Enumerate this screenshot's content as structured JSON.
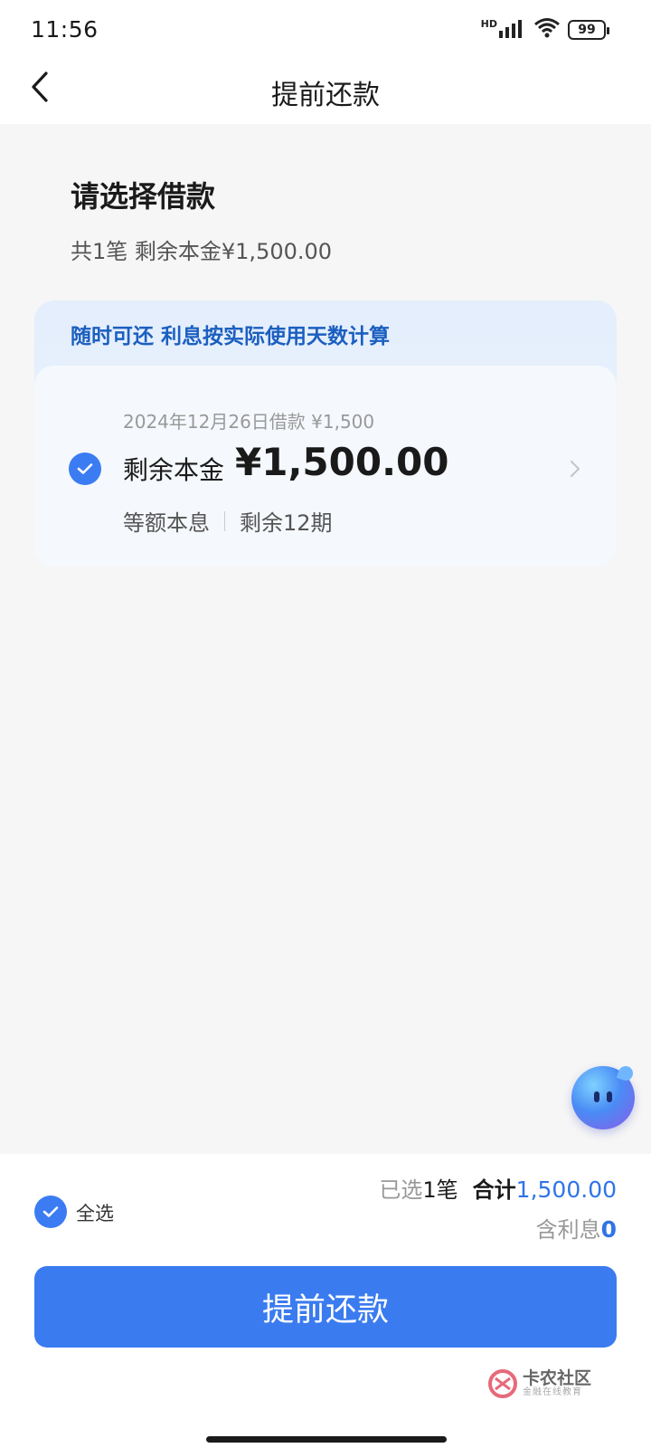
{
  "status_bar": {
    "time": "11:56",
    "battery_level": "99",
    "network_label": "HD",
    "icons": [
      "hd-icon",
      "signal-icon",
      "wifi-icon",
      "battery-icon"
    ]
  },
  "header": {
    "title": "提前还款"
  },
  "section": {
    "title": "请选择借款",
    "subtitle": "共1笔 剩余本金¥1,500.00"
  },
  "loan_card": {
    "banner": "随时可还 利息按实际使用天数计算",
    "loan_info": "2024年12月26日借款 ¥1,500",
    "principal_label": "剩余本金",
    "principal_value": "¥1,500.00",
    "repayment_type": "等额本息",
    "remaining_periods": "剩余12期",
    "selected": true
  },
  "footer": {
    "select_all_label": "全选",
    "selected_prefix": "已选",
    "selected_count": "1笔",
    "total_label": "合计",
    "total_value": "1,500.00",
    "interest_label": "含利息",
    "interest_value": "0",
    "submit_label": "提前还款"
  },
  "watermark": {
    "main": "卡农社区",
    "sub": "金融在线教育"
  },
  "colors": {
    "accent": "#3a7bf0",
    "banner_text": "#1b5fc0",
    "background": "#f6f6f6"
  }
}
